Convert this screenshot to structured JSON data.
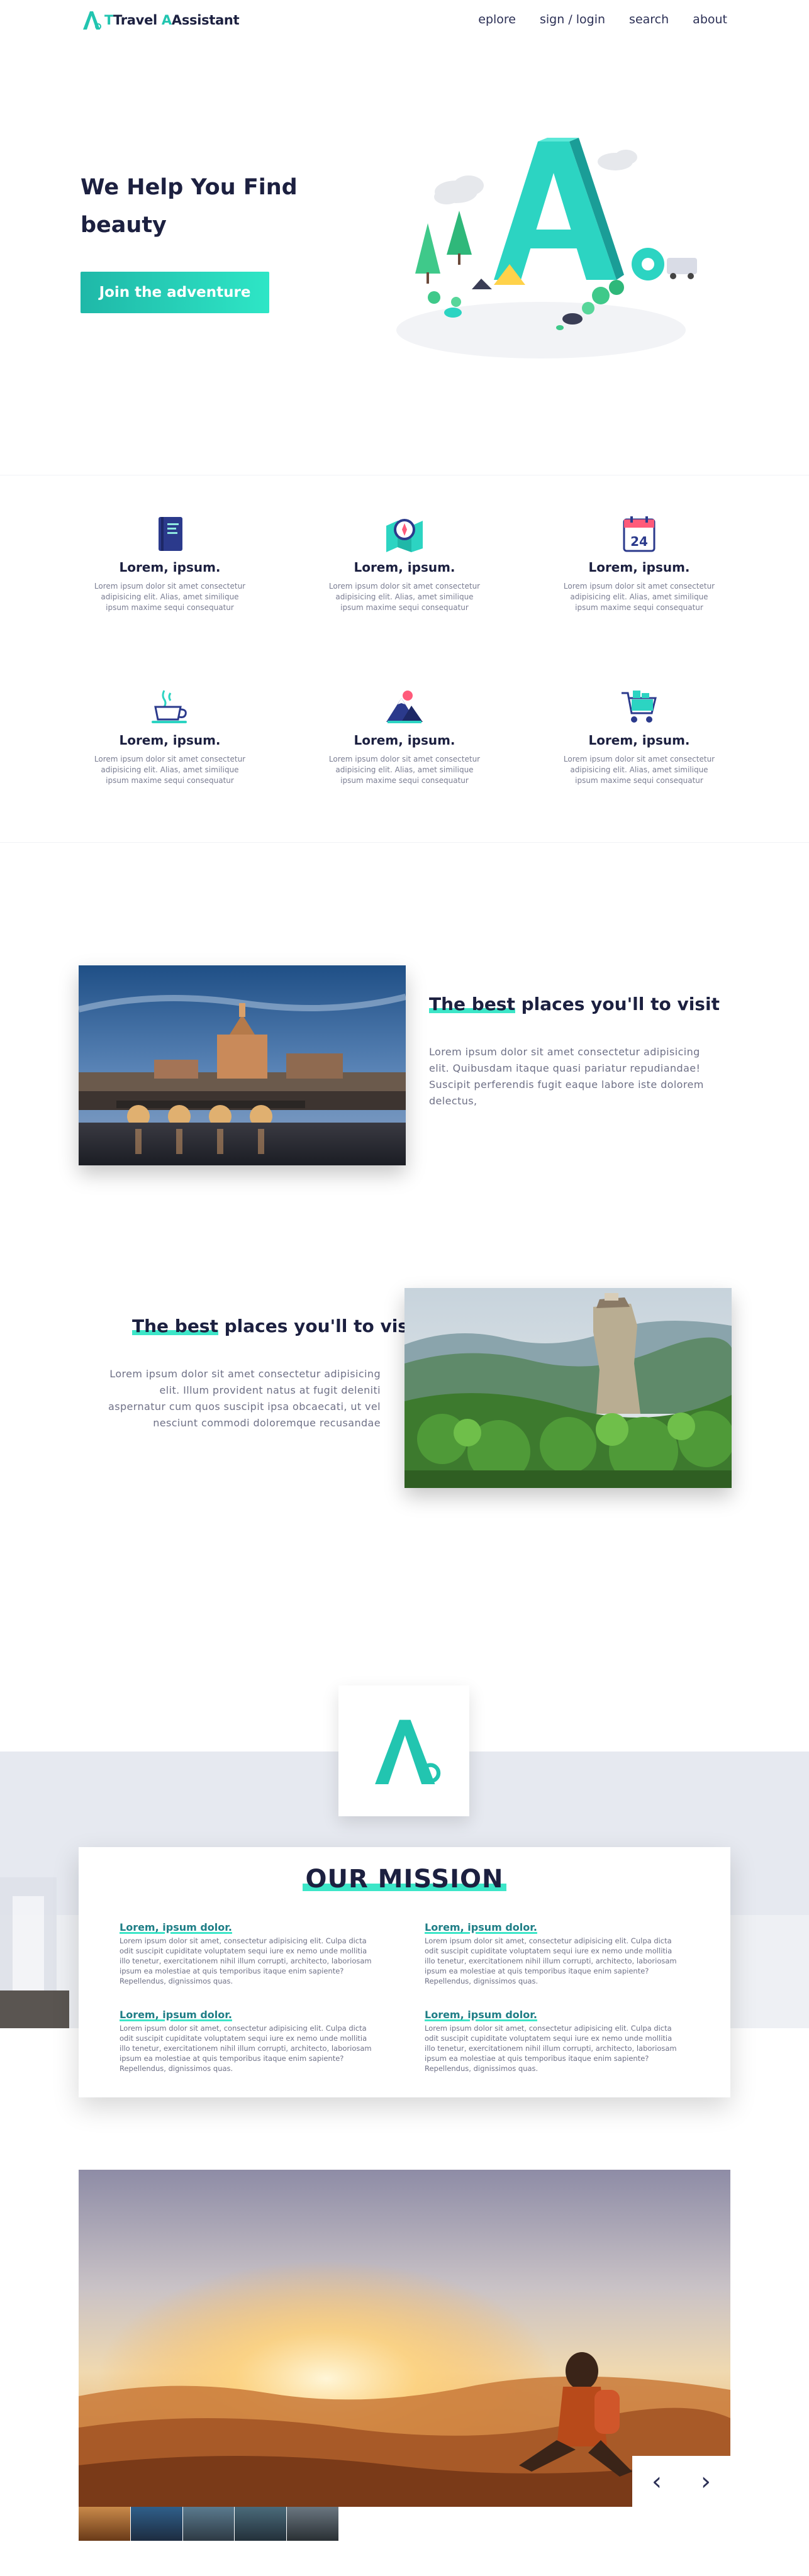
{
  "nav": {
    "logo_text_1": "Travel",
    "logo_text_2": "Assistant",
    "logo_t1_first": "T",
    "logo_t2_first": "A",
    "links": [
      "eplore",
      "sign / login",
      "search",
      "about"
    ]
  },
  "hero": {
    "title_line1": "We Help You Find",
    "title_line2": "beauty",
    "cta": "Join the adventure"
  },
  "features": [
    {
      "icon": "book-icon",
      "title": "Lorem, ipsum.",
      "text": "Lorem ipsum dolor sit amet consectetur adipisicing elit. Alias, amet similique ipsum maxime sequi consequatur"
    },
    {
      "icon": "map-compass-icon",
      "title": "Lorem, ipsum.",
      "text": "Lorem ipsum dolor sit amet consectetur adipisicing elit. Alias, amet similique ipsum maxime sequi consequatur"
    },
    {
      "icon": "calendar-icon",
      "title": "Lorem, ipsum.",
      "text": "Lorem ipsum dolor sit amet consectetur adipisicing elit. Alias, amet similique ipsum maxime sequi consequatur"
    },
    {
      "icon": "coffee-cup-icon",
      "title": "Lorem, ipsum.",
      "text": "Lorem ipsum dolor sit amet consectetur adipisicing elit. Alias, amet similique ipsum maxime sequi consequatur"
    },
    {
      "icon": "mountain-icon",
      "title": "Lorem, ipsum.",
      "text": "Lorem ipsum dolor sit amet consectetur adipisicing elit. Alias, amet similique ipsum maxime sequi consequatur"
    },
    {
      "icon": "cart-icon",
      "title": "Lorem, ipsum.",
      "text": "Lorem ipsum dolor sit amet consectetur adipisicing elit. Alias, amet similique ipsum maxime sequi consequatur"
    }
  ],
  "calendar_day": "24",
  "places": [
    {
      "title_highlight": "The best",
      "title_rest": " places you'll to visit",
      "text": "Lorem ipsum dolor sit amet consectetur adipisicing elit. Quibusdam itaque quasi pariatur repudiandae! Suscipit perferendis fugit eaque labore iste dolorem delectus,"
    },
    {
      "title_highlight": "The best",
      "title_rest": " places you'll to visit",
      "text": "Lorem ipsum dolor sit amet consectetur adipisicing elit. Illum provident natus at fugit deleniti aspernatur cum quos suscipit ipsa obcaecati, ut vel nesciunt commodi doloremque recusandae"
    }
  ],
  "mission": {
    "title": "OUR MISSION",
    "blocks": [
      {
        "heading": "Lorem, ipsum dolor.",
        "text": "Lorem ipsum dolor sit amet, consectetur adipisicing elit. Culpa dicta odit suscipit cupiditate voluptatem sequi iure ex nemo unde mollitia illo tenetur, exercitationem nihil illum corrupti, architecto, laboriosam ipsum ea molestiae at quis temporibus itaque enim sapiente? Repellendus, dignissimos quas."
      },
      {
        "heading": "Lorem, ipsum dolor.",
        "text": "Lorem ipsum dolor sit amet, consectetur adipisicing elit. Culpa dicta odit suscipit cupiditate voluptatem sequi iure ex nemo unde mollitia illo tenetur, exercitationem nihil illum corrupti, architecto, laboriosam ipsum ea molestiae at quis temporibus itaque enim sapiente? Repellendus, dignissimos quas."
      },
      {
        "heading": "Lorem, ipsum dolor.",
        "text": "Lorem ipsum dolor sit amet, consectetur adipisicing elit. Culpa dicta odit suscipit cupiditate voluptatem sequi iure ex nemo unde mollitia illo tenetur, exercitationem nihil illum corrupti, architecto, laboriosam ipsum ea molestiae at quis temporibus itaque enim sapiente? Repellendus, dignissimos quas."
      },
      {
        "heading": "Lorem, ipsum dolor.",
        "text": "Lorem ipsum dolor sit amet, consectetur adipisicing elit. Culpa dicta odit suscipit cupiditate voluptatem sequi iure ex nemo unde mollitia illo tenetur, exercitationem nihil illum corrupti, architecto, laboriosam ipsum ea molestiae at quis temporibus itaque enim sapiente? Repellendus, dignissimos quas."
      }
    ]
  },
  "gallery": {
    "prev": "‹",
    "next": "›"
  },
  "colors": {
    "accent": "#3de6c8",
    "accent_dark": "#1fb8a8",
    "navy": "#1c2040"
  }
}
